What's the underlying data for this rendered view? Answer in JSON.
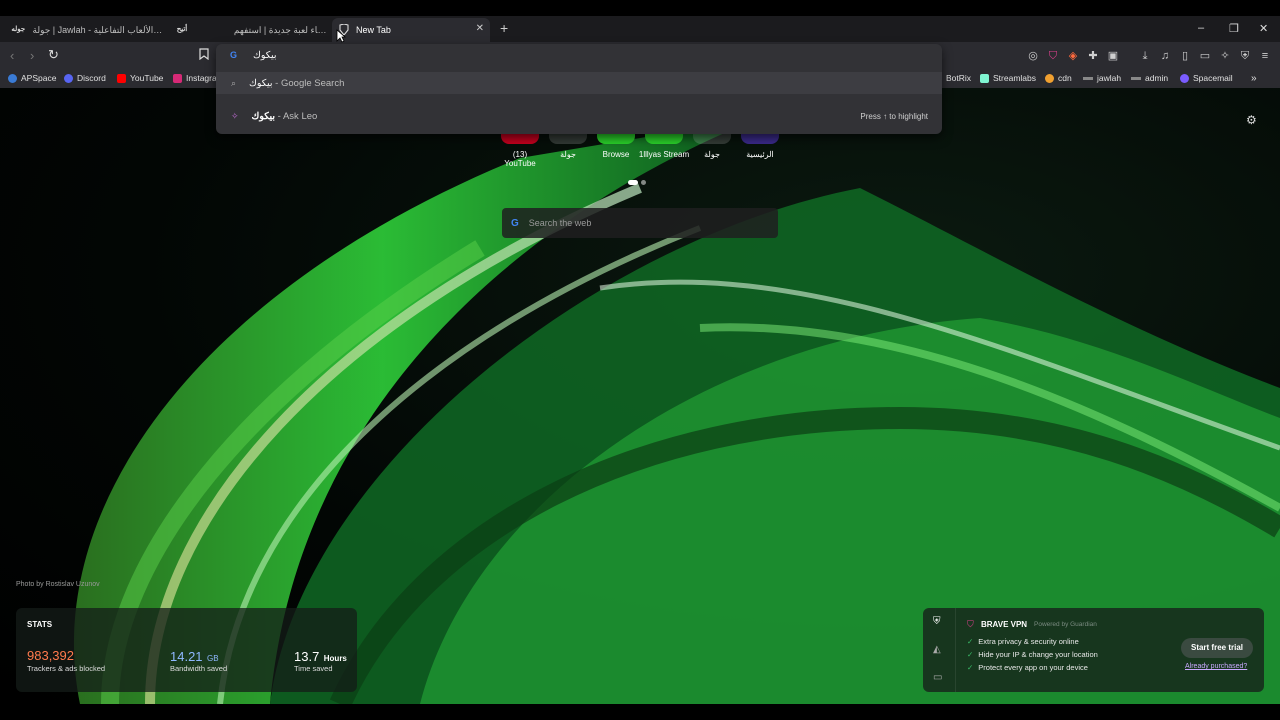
{
  "tabs": [
    {
      "title": "جولة | Jawlah - منصة الألعاب التفاعلية",
      "favicon": "جوله"
    },
    {
      "title": "إنشاء لعبة جديدة | استفهم",
      "favicon": "أتيح"
    },
    {
      "title": "New Tab",
      "favicon": "brave-icon"
    }
  ],
  "window": {
    "minimize": "–",
    "maximize": "❐",
    "close": "✕"
  },
  "newtab_label": "+",
  "omnibox": {
    "value": "بيكوك",
    "suggestions": [
      {
        "term": "بيكوك",
        "suffix": " - Google Search"
      },
      {
        "term": "بيكوك",
        "suffix": " - Ask Leo",
        "hint": "Press ↑ to highlight"
      }
    ]
  },
  "bookmarks_left": [
    {
      "label": "APSpace",
      "color": "#3a7bd5"
    },
    {
      "label": "Discord",
      "color": "#5865f2"
    },
    {
      "label": "YouTube",
      "color": "#ff0000"
    },
    {
      "label": "Instagra",
      "color": "#d62976"
    }
  ],
  "bookmarks_right": [
    {
      "label": "BotRix",
      "color": "#ffffff"
    },
    {
      "label": "Streamlabs",
      "color": "#80f5d2"
    },
    {
      "label": "cdn",
      "color": "#f0a030"
    },
    {
      "label": "jawlah",
      "color": "#cccccc"
    },
    {
      "label": "admin",
      "color": "#cccccc"
    },
    {
      "label": "Spacemail",
      "color": "#7a5cff"
    }
  ],
  "top_sites": [
    "(13) YouTube",
    "جولة",
    "Browse",
    "1lllyas Stream",
    "جولة",
    "الرئيسية"
  ],
  "search_placeholder": "Search the web",
  "photo_credit": "Photo by Rostislav Uzunov",
  "stats": {
    "heading": "STATS",
    "trackers_value": "983,392",
    "trackers_label": "Trackers & ads blocked",
    "bandwidth_value": "14.21",
    "bandwidth_unit": "GB",
    "bandwidth_label": "Bandwidth saved",
    "time_value": "13.7",
    "time_unit": "Hours",
    "time_label": "Time saved"
  },
  "vpn": {
    "title": "BRAVE VPN",
    "powered": "Powered by Guardian",
    "features": [
      "Extra privacy & security online",
      "Hide your IP & change your location",
      "Protect every app on your device"
    ],
    "cta": "Start free trial",
    "purchased": "Already purchased?"
  },
  "colors": {
    "stats_trackers": "#ff7a4d",
    "stats_bandwidth": "#8fb8ff",
    "vpn_check": "#3bbf6b"
  }
}
